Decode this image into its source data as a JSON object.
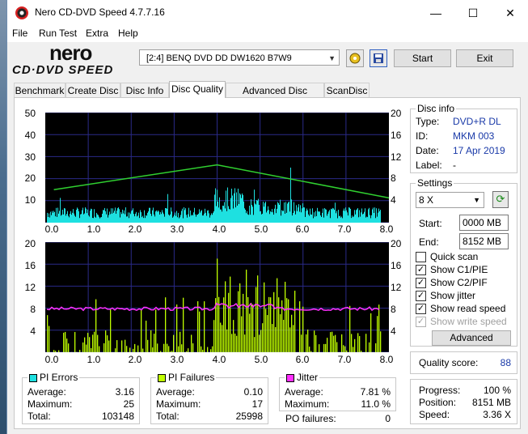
{
  "window": {
    "title": "Nero CD-DVD Speed 4.7.7.16",
    "minimize": "—",
    "maximize": "☐",
    "close": "✕"
  },
  "menu": [
    "File",
    "Run Test",
    "Extra",
    "Help"
  ],
  "logo": {
    "top": "nero",
    "bottom": "CD·DVD SPEED"
  },
  "toolbar": {
    "drive": "[2:4]   BENQ DVD DD DW1620 B7W9",
    "start": "Start",
    "exit": "Exit"
  },
  "tabs": [
    "Benchmark",
    "Create Disc",
    "Disc Info",
    "Disc Quality",
    "Advanced Disc Quality",
    "ScanDisc"
  ],
  "top_chart": {
    "y_left": [
      "50",
      "40",
      "30",
      "20",
      "10"
    ],
    "y_right": [
      "20",
      "16",
      "12",
      "8",
      "4"
    ],
    "x": [
      "0.0",
      "1.0",
      "2.0",
      "3.0",
      "4.0",
      "5.0",
      "6.0",
      "7.0",
      "8.0"
    ]
  },
  "bottom_chart": {
    "y_left": [
      "20",
      "16",
      "12",
      "8",
      "4"
    ],
    "y_right": [
      "20",
      "16",
      "12",
      "8",
      "4"
    ],
    "x": [
      "0.0",
      "1.0",
      "2.0",
      "3.0",
      "4.0",
      "5.0",
      "6.0",
      "7.0",
      "8.0"
    ]
  },
  "chart_data": [
    {
      "type": "bar",
      "name": "PI Errors",
      "x_range": [
        0,
        8
      ],
      "ylim": [
        0,
        50
      ],
      "average": 3.16,
      "maximum": 25
    },
    {
      "type": "line",
      "name": "Read speed",
      "x_range": [
        0,
        8
      ],
      "ylim": [
        0,
        20
      ],
      "x": [
        0.2,
        4.0,
        8.0
      ],
      "y": [
        6,
        10.5,
        4.5
      ]
    },
    {
      "type": "bar",
      "name": "PI Failures",
      "x_range": [
        0,
        8
      ],
      "ylim": [
        0,
        20
      ],
      "average": 0.1,
      "maximum": 17
    },
    {
      "type": "line",
      "name": "Jitter",
      "x_range": [
        0,
        8
      ],
      "ylim": [
        0,
        20
      ],
      "average": 7.81,
      "maximum": 11.0
    }
  ],
  "colors": {
    "pi_errors": "#1ee0e0",
    "pi_failures": "#c0ff00",
    "jitter": "#ff30ff",
    "speed": "#30d030",
    "plot_bg": "#000000",
    "grid": "#2a2a88"
  },
  "pi_errors": {
    "title": "PI Errors",
    "avg_label": "Average:",
    "avg": "3.16",
    "max_label": "Maximum:",
    "max": "25",
    "total_label": "Total:",
    "total": "103148"
  },
  "pi_failures": {
    "title": "PI Failures",
    "avg_label": "Average:",
    "avg": "0.10",
    "max_label": "Maximum:",
    "max": "17",
    "total_label": "Total:",
    "total": "25998"
  },
  "jitter": {
    "title": "Jitter",
    "avg_label": "Average:",
    "avg": "7.81 %",
    "max_label": "Maximum:",
    "max": "11.0 %",
    "po_label": "PO failures:",
    "po": "0"
  },
  "disc_info": {
    "title": "Disc info",
    "type_label": "Type:",
    "type": "DVD+R DL",
    "id_label": "ID:",
    "id": "MKM 003",
    "date_label": "Date:",
    "date": "17 Apr 2019",
    "label_label": "Label:",
    "label": "-"
  },
  "settings": {
    "title": "Settings",
    "speed": "8 X",
    "start_label": "Start:",
    "start": "0000 MB",
    "end_label": "End:",
    "end": "8152 MB",
    "quick_scan": "Quick scan",
    "c1pie": "Show C1/PIE",
    "c2pif": "Show C2/PIF",
    "jitter": "Show jitter",
    "read_speed": "Show read speed",
    "write_speed": "Show write speed",
    "advanced": "Advanced"
  },
  "quality": {
    "label": "Quality score:",
    "value": "88"
  },
  "progress": {
    "progress_label": "Progress:",
    "progress": "100 %",
    "position_label": "Position:",
    "position": "8151 MB",
    "speed_label": "Speed:",
    "speed": "3.36 X"
  }
}
